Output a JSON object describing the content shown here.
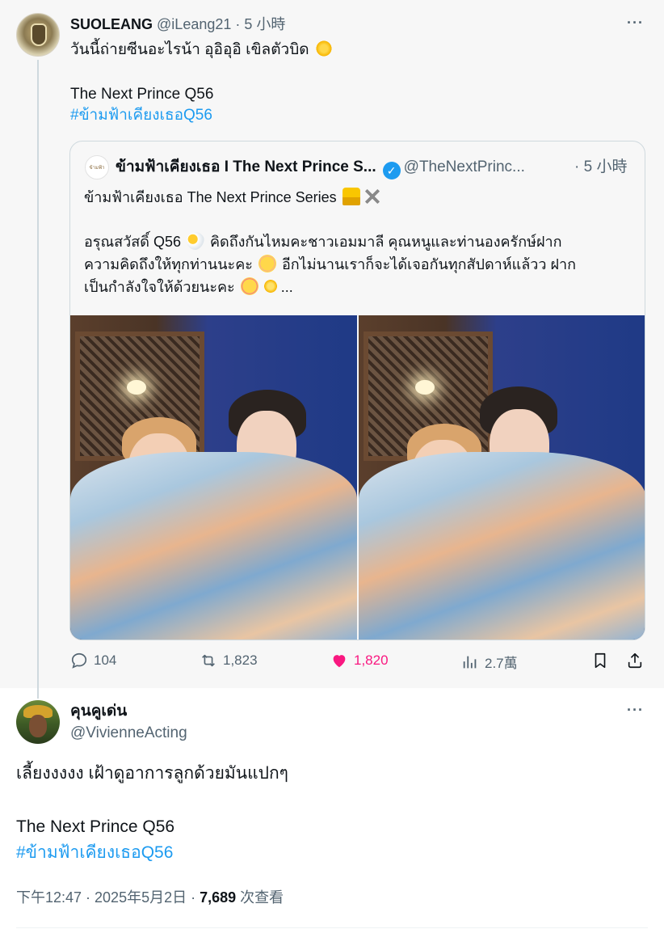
{
  "post1": {
    "display_name": "SUOLEANG",
    "handle": "@iLeang21",
    "separator": " · ",
    "time": "5 小時",
    "more_label": "···",
    "text_line1": "วันนี้ถ่ายซีนอะไรน้า อุอิอุอิ เขิลตัวบิด",
    "text_line2": "The Next Prince Q56",
    "hashtag": "#ข้ามฟ้าเคียงเธอQ56"
  },
  "quote": {
    "avatar_text": "ข้ามฟ้า เคียงเธอ",
    "display_name": "ข้ามฟ้าเคียงเธอ I The Next Prince S...",
    "verified_mark": "✓",
    "handle": "@TheNextPrinc...",
    "time": "· 5 小時",
    "line1": "ข้ามฟ้าเคียงเธอ The Next Prince Series",
    "line2": "อรุณสวัสดิ์ Q56",
    "line2b": "คิดถึงกันไหมคะชาวเอมมาลี คุณหนูและท่านองครักษ์ฝาก",
    "line3": "ความคิดถึงให้ทุกท่านนะคะ",
    "line3b": "อีกไม่นานเราก็จะได้เจอกันทุกสัปดาห์แล้วว ฝาก",
    "line4": "เป็นกำลังใจให้ด้วยนะคะ",
    "line4b": "..."
  },
  "actions": {
    "replies": "104",
    "reposts": "1,823",
    "likes": "1,820",
    "views": "2.7萬"
  },
  "post2": {
    "display_name": "คุนคูเด่น",
    "handle": "@VivienneActing",
    "more_label": "···",
    "text_line1": "เลี้ยงงงงง เฝ้าดูอาการลูกด้วยมันแปกๆ",
    "text_line2": "The Next Prince Q56",
    "hashtag": "#ข้ามฟ้าเคียงเธอQ56",
    "timestamp": "下午12:47 · 2025年5月2日 · ",
    "view_count": "7,689",
    "view_label": " 次查看"
  },
  "colors": {
    "accent": "#1d9bf0",
    "like": "#f91880",
    "secondary_text": "#536471"
  },
  "icons": [
    "reply-icon",
    "repost-icon",
    "heart-icon",
    "views-icon",
    "bookmark-icon",
    "share-icon",
    "verified-icon",
    "more-icon"
  ]
}
